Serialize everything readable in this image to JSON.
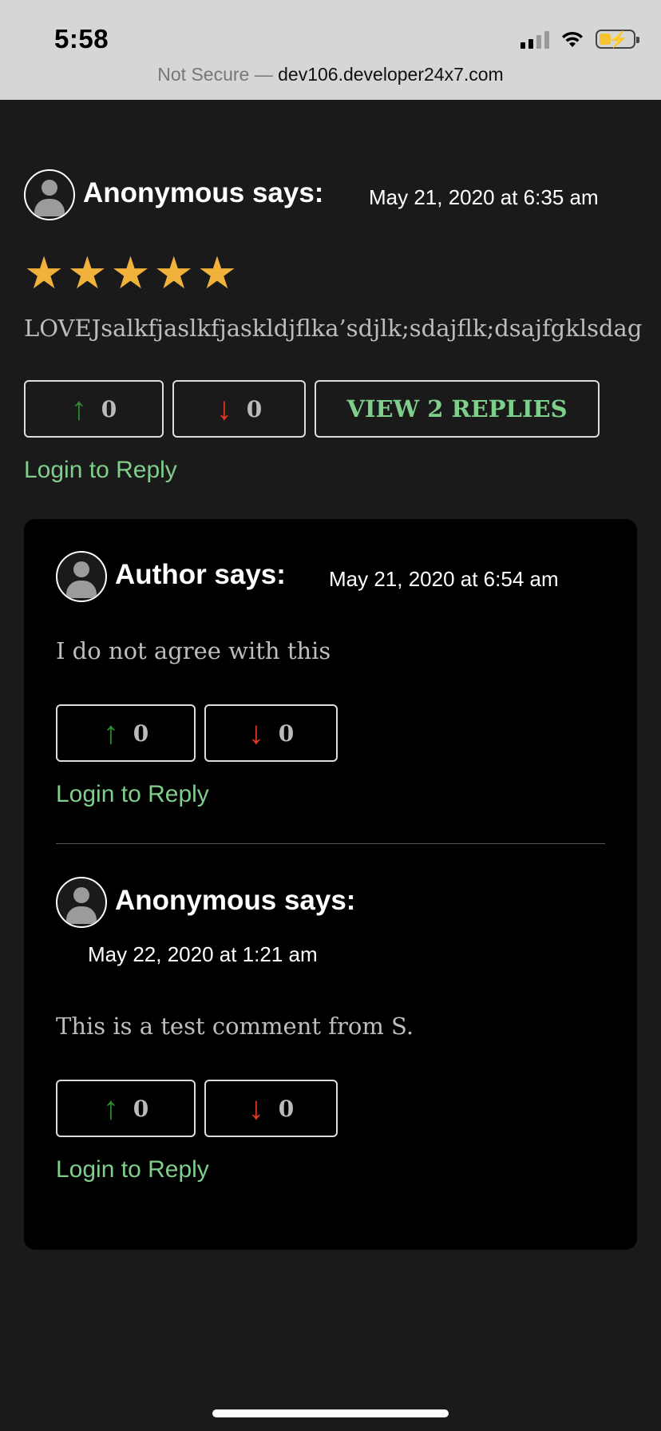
{
  "status_bar": {
    "time": "5:58",
    "url_prefix": "Not Secure — ",
    "url_host": "dev106.developer24x7.com"
  },
  "comment": {
    "author_says": "Anonymous says:",
    "date": "May 21, 2020 at 6:35 am",
    "rating": 5,
    "text": "LOVEJsalkfjaslkfjaskldjflka’sdjlk;sdajflk;dsajfgklsdag",
    "upvotes": "0",
    "downvotes": "0",
    "view_replies_label": "VIEW 2 REPLIES",
    "login_label": "Login to Reply"
  },
  "replies": [
    {
      "author_says": "Author says:",
      "date": "May 21, 2020 at 6:54 am",
      "text": "I do not agree with this",
      "upvotes": "0",
      "downvotes": "0",
      "login_label": "Login to Reply"
    },
    {
      "author_says": "Anonymous says:",
      "date": "May 22, 2020 at 1:21 am",
      "text": "This is a test comment from S.",
      "upvotes": "0",
      "downvotes": "0",
      "login_label": "Login to Reply"
    }
  ],
  "icons": {
    "upvote": "arrow-up-icon",
    "downvote": "arrow-down-icon",
    "star": "star-icon",
    "avatar": "user-avatar-icon"
  },
  "colors": {
    "accent_green": "#7fce8c",
    "star": "#f0b23a",
    "upvote": "#2e8b2e",
    "downvote": "#e23a24",
    "background": "#1a1a1a",
    "reply_panel": "#000000"
  }
}
